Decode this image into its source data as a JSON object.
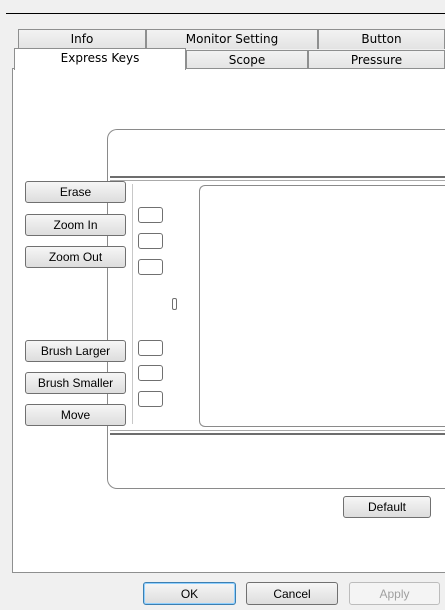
{
  "tabs_row1": [
    {
      "label": "Info"
    },
    {
      "label": "Monitor Setting"
    },
    {
      "label": "Button"
    }
  ],
  "tabs_row2": [
    {
      "label": "Express Keys",
      "selected": true
    },
    {
      "label": "Scope"
    },
    {
      "label": "Pressure"
    }
  ],
  "express_keys": {
    "group_top": [
      "Erase",
      "Zoom In",
      "Zoom Out"
    ],
    "group_bottom": [
      "Brush Larger",
      "Brush Smaller",
      "Move"
    ]
  },
  "default_label": "Default",
  "dialog_buttons": {
    "ok": "OK",
    "cancel": "Cancel",
    "apply": "Apply"
  }
}
